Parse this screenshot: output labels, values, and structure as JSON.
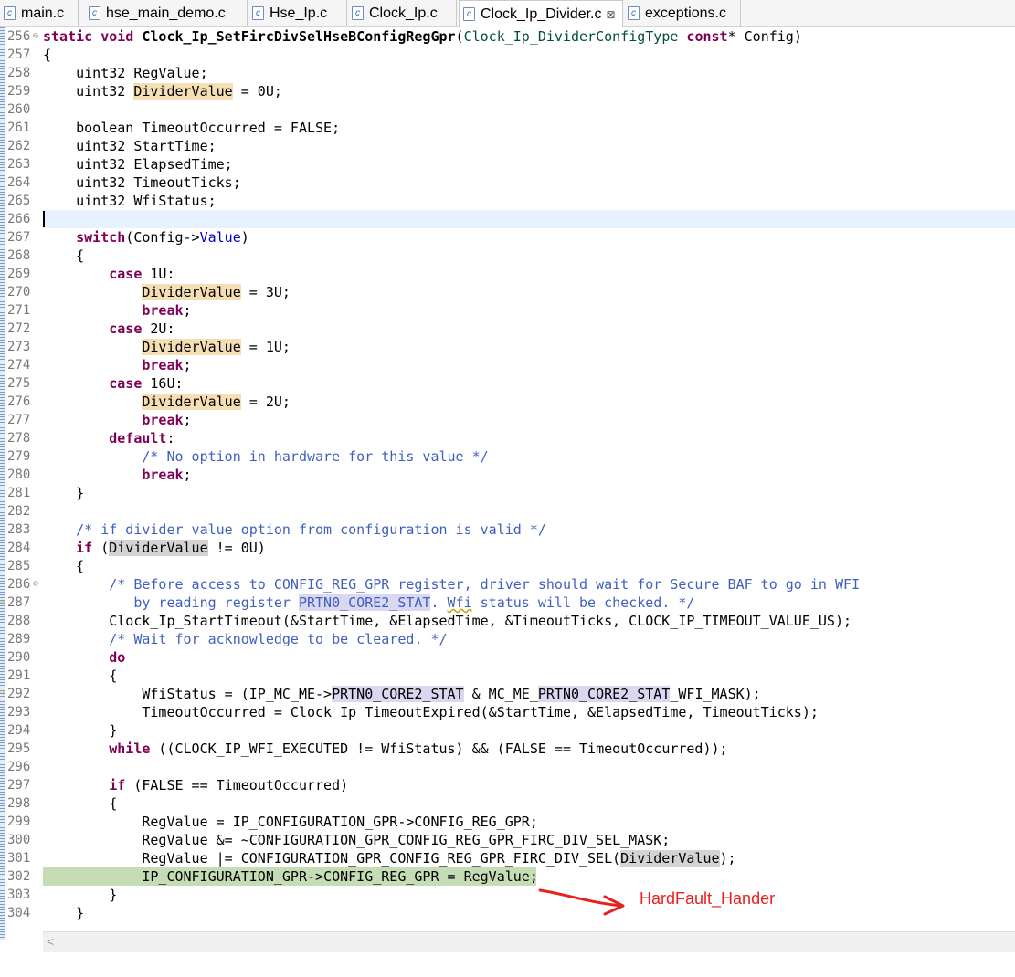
{
  "tabs": [
    {
      "label": "main.c",
      "active": false
    },
    {
      "label": "hse_main_demo.c",
      "active": false
    },
    {
      "label": "Hse_Ip.c",
      "active": false
    },
    {
      "label": "Clock_Ip.c",
      "active": false
    },
    {
      "label": "Clock_Ip_Divider.c",
      "active": true
    },
    {
      "label": "exceptions.c",
      "active": false
    }
  ],
  "file_icon_glyph": "c",
  "close_glyph": "⊠",
  "editor": {
    "current_line": 266,
    "debug_line": 302,
    "lines": [
      {
        "n": "256",
        "fold": "⊖"
      },
      {
        "n": "257"
      },
      {
        "n": "258"
      },
      {
        "n": "259"
      },
      {
        "n": "260"
      },
      {
        "n": "261"
      },
      {
        "n": "262"
      },
      {
        "n": "263"
      },
      {
        "n": "264"
      },
      {
        "n": "265"
      },
      {
        "n": "266"
      },
      {
        "n": "267"
      },
      {
        "n": "268"
      },
      {
        "n": "269"
      },
      {
        "n": "270"
      },
      {
        "n": "271"
      },
      {
        "n": "272"
      },
      {
        "n": "273"
      },
      {
        "n": "274"
      },
      {
        "n": "275"
      },
      {
        "n": "276"
      },
      {
        "n": "277"
      },
      {
        "n": "278"
      },
      {
        "n": "279"
      },
      {
        "n": "280"
      },
      {
        "n": "281"
      },
      {
        "n": "282"
      },
      {
        "n": "283"
      },
      {
        "n": "284"
      },
      {
        "n": "285"
      },
      {
        "n": "286",
        "fold": "⊖"
      },
      {
        "n": "287",
        "marker": true
      },
      {
        "n": "288"
      },
      {
        "n": "289"
      },
      {
        "n": "290"
      },
      {
        "n": "291"
      },
      {
        "n": "292",
        "marker": true
      },
      {
        "n": "293"
      },
      {
        "n": "294"
      },
      {
        "n": "295"
      },
      {
        "n": "296"
      },
      {
        "n": "297"
      },
      {
        "n": "298"
      },
      {
        "n": "299"
      },
      {
        "n": "300"
      },
      {
        "n": "301"
      },
      {
        "n": "302"
      },
      {
        "n": "303"
      },
      {
        "n": "304"
      }
    ],
    "code": {
      "l256_kw": "static void ",
      "l256_fn": "Clock_Ip_SetFircDivSelHseBConfigRegGpr",
      "l256_p1": "(",
      "l256_type": "Clock_Ip_DividerConfigType",
      "l256_sp": " ",
      "l256_const": "const",
      "l256_rest": "* Config)",
      "l257": "{",
      "l258": "    uint32 RegValue;",
      "l259_a": "    uint32 ",
      "l259_hl": "DividerValue",
      "l259_b": " = 0U;",
      "l261": "    boolean TimeoutOccurred = FALSE;",
      "l262": "    uint32 StartTime;",
      "l263": "    uint32 ElapsedTime;",
      "l264": "    uint32 TimeoutTicks;",
      "l265": "    uint32 WfiStatus;",
      "l267_ind": "    ",
      "l267_kw": "switch",
      "l267_a": "(Config->",
      "l267_fd": "Value",
      "l267_b": ")",
      "l268": "    {",
      "case_ind": "        ",
      "case_kw": "case",
      "l269_v": " 1U:",
      "l272_v": " 2U:",
      "l275_v": " 16U:",
      "body_ind": "            ",
      "dv": "DividerValue",
      "l270_v": " = 3U;",
      "l273_v": " = 1U;",
      "l276_v": " = 2U;",
      "break_kw": "break",
      "semi": ";",
      "default_kw": "default",
      "colon": ":",
      "l279_cm": "/* No option in hardware for this value */",
      "l281": "    }",
      "l283_ind": "    ",
      "l283_cm": "/* if divider value option from configuration is valid */",
      "l284_ind": "    ",
      "l284_kw": "if",
      "l284_a": " (",
      "l284_oc": "DividerValue",
      "l284_b": " != 0U)",
      "l285": "    {",
      "l286_ind": "        ",
      "l286_cm": "/* Before access to CONFIG_REG_GPR register, driver should wait for Secure BAF to go in WFI",
      "l287_cm_a": "           by reading register ",
      "l287_mc": "PRTN0_CORE2_STAT",
      "l287_cm_b": ". ",
      "l287_warn": "Wfi",
      "l287_cm_c": " status will be checked. */",
      "l288": "        Clock_Ip_StartTimeout(&StartTime, &ElapsedTime, &TimeoutTicks, CLOCK_IP_TIMEOUT_VALUE_US);",
      "l289_ind": "        ",
      "l289_cm": "/* Wait for acknowledge to be cleared. */",
      "l290_ind": "        ",
      "l290_kw": "do",
      "l291": "        {",
      "l292_a": "            WfiStatus = (IP_MC_ME->",
      "l292_mc1": "PRTN0_CORE2_STAT",
      "l292_b": " & MC_ME_",
      "l292_mc2": "PRTN0_CORE2_STAT",
      "l292_c": "_WFI_MASK);",
      "l293": "            TimeoutOccurred = Clock_Ip_TimeoutExpired(&StartTime, &ElapsedTime, TimeoutTicks);",
      "l294": "        }",
      "l295_ind": "        ",
      "l295_kw": "while",
      "l295_a": " ((CLOCK_IP_WFI_EXECUTED != WfiStatus) && (FALSE == TimeoutOccurred));",
      "l297_ind": "        ",
      "l297_kw": "if",
      "l297_a": " (FALSE == TimeoutOccurred)",
      "l298": "        {",
      "l299": "            RegValue = IP_CONFIGURATION_GPR->CONFIG_REG_GPR;",
      "l300": "            RegValue &= ~CONFIGURATION_GPR_CONFIG_REG_GPR_FIRC_DIV_SEL_MASK;",
      "l301_a": "            RegValue |= CONFIGURATION_GPR_CONFIG_REG_GPR_FIRC_DIV_SEL(",
      "l301_oc": "DividerValue",
      "l301_b": ");",
      "l302": "            IP_CONFIGURATION_GPR->CONFIG_REG_GPR = RegValue;",
      "l303": "        }",
      "l304": "    }"
    }
  },
  "scrollbar": {
    "left_arrow": "<"
  },
  "annotation": {
    "text": "HardFault_Hander",
    "color": "#e8201e"
  }
}
